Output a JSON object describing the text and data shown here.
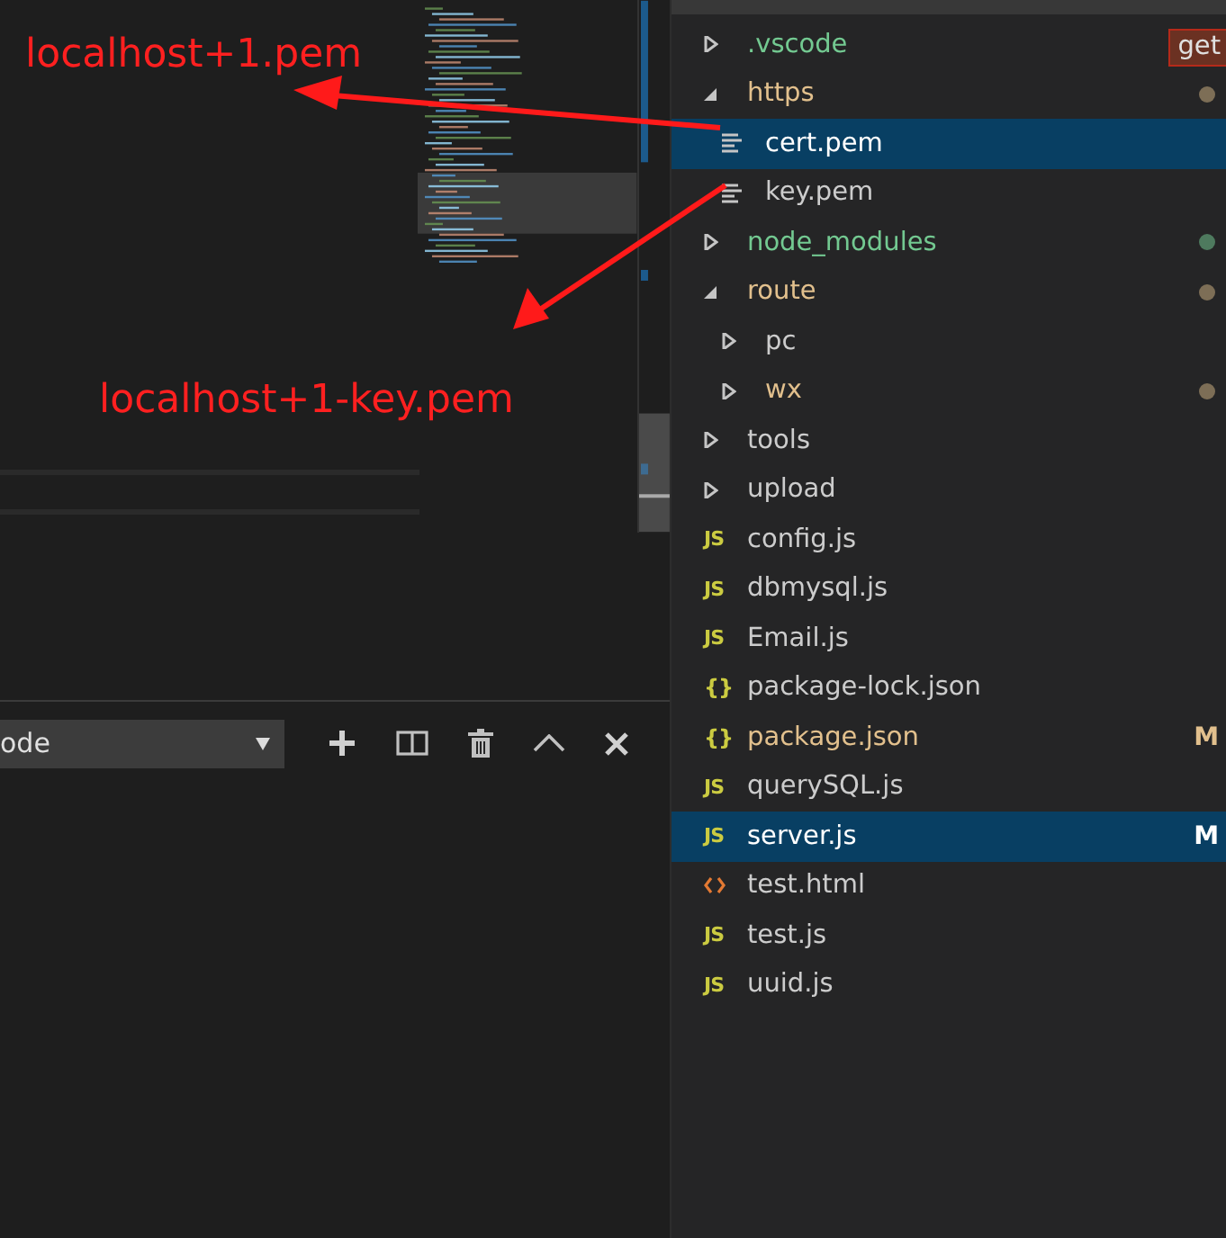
{
  "annotations": [
    {
      "text": "localhost+1.pem"
    },
    {
      "text": "localhost+1-key.pem"
    }
  ],
  "panel": {
    "terminal_select": {
      "value": "ode"
    }
  },
  "explorer": {
    "tag": {
      "text": "get"
    },
    "tree": [
      {
        "name": ".vscode",
        "kind": "folder",
        "expanded": false,
        "color": "#73c991",
        "selected": false
      },
      {
        "name": "https",
        "kind": "folder",
        "expanded": true,
        "color": "#e2c08d",
        "dot": {
          "color": "#7d6e56"
        },
        "selected": false,
        "children": [
          {
            "name": "cert.pem",
            "kind": "pem",
            "color": "#ffffff",
            "selected": true
          },
          {
            "name": "key.pem",
            "kind": "pem",
            "color": "#cccccc",
            "selected": false
          }
        ]
      },
      {
        "name": "node_modules",
        "kind": "folder",
        "expanded": false,
        "color": "#73c991",
        "dot": {
          "color": "#4e7a5e"
        },
        "selected": false
      },
      {
        "name": "route",
        "kind": "folder",
        "expanded": true,
        "color": "#e2c08d",
        "dot": {
          "color": "#7d6e56"
        },
        "selected": false,
        "children": [
          {
            "name": "pc",
            "kind": "folder",
            "expanded": false,
            "color": "#cccccc",
            "selected": false
          },
          {
            "name": "wx",
            "kind": "folder",
            "expanded": false,
            "color": "#e2c08d",
            "dot": {
              "color": "#7d6e56"
            },
            "selected": false
          }
        ]
      },
      {
        "name": "tools",
        "kind": "folder",
        "expanded": false,
        "color": "#cccccc",
        "selected": false
      },
      {
        "name": "upload",
        "kind": "folder",
        "expanded": false,
        "color": "#cccccc",
        "selected": false
      },
      {
        "name": "config.js",
        "kind": "js",
        "icon": "JS",
        "color": "#cccccc",
        "selected": false
      },
      {
        "name": "dbmysql.js",
        "kind": "js",
        "icon": "JS",
        "color": "#cccccc",
        "selected": false
      },
      {
        "name": "Email.js",
        "kind": "js",
        "icon": "JS",
        "color": "#cccccc",
        "selected": false
      },
      {
        "name": "package-lock.json",
        "kind": "json",
        "icon": "{}",
        "color": "#cccccc",
        "selected": false
      },
      {
        "name": "package.json",
        "kind": "json",
        "icon": "{}",
        "color": "#e2c08d",
        "badge": "M",
        "selected": false
      },
      {
        "name": "querySQL.js",
        "kind": "js",
        "icon": "JS",
        "color": "#cccccc",
        "selected": false
      },
      {
        "name": "server.js",
        "kind": "js",
        "icon": "JS",
        "color": "#ffffff",
        "badge": "M",
        "selected": true
      },
      {
        "name": "test.html",
        "kind": "html",
        "color": "#cccccc",
        "selected": false
      },
      {
        "name": "test.js",
        "kind": "js",
        "icon": "JS",
        "color": "#cccccc",
        "selected": false
      },
      {
        "name": "uuid.js",
        "kind": "js",
        "icon": "JS",
        "color": "#cccccc",
        "selected": false
      }
    ]
  }
}
